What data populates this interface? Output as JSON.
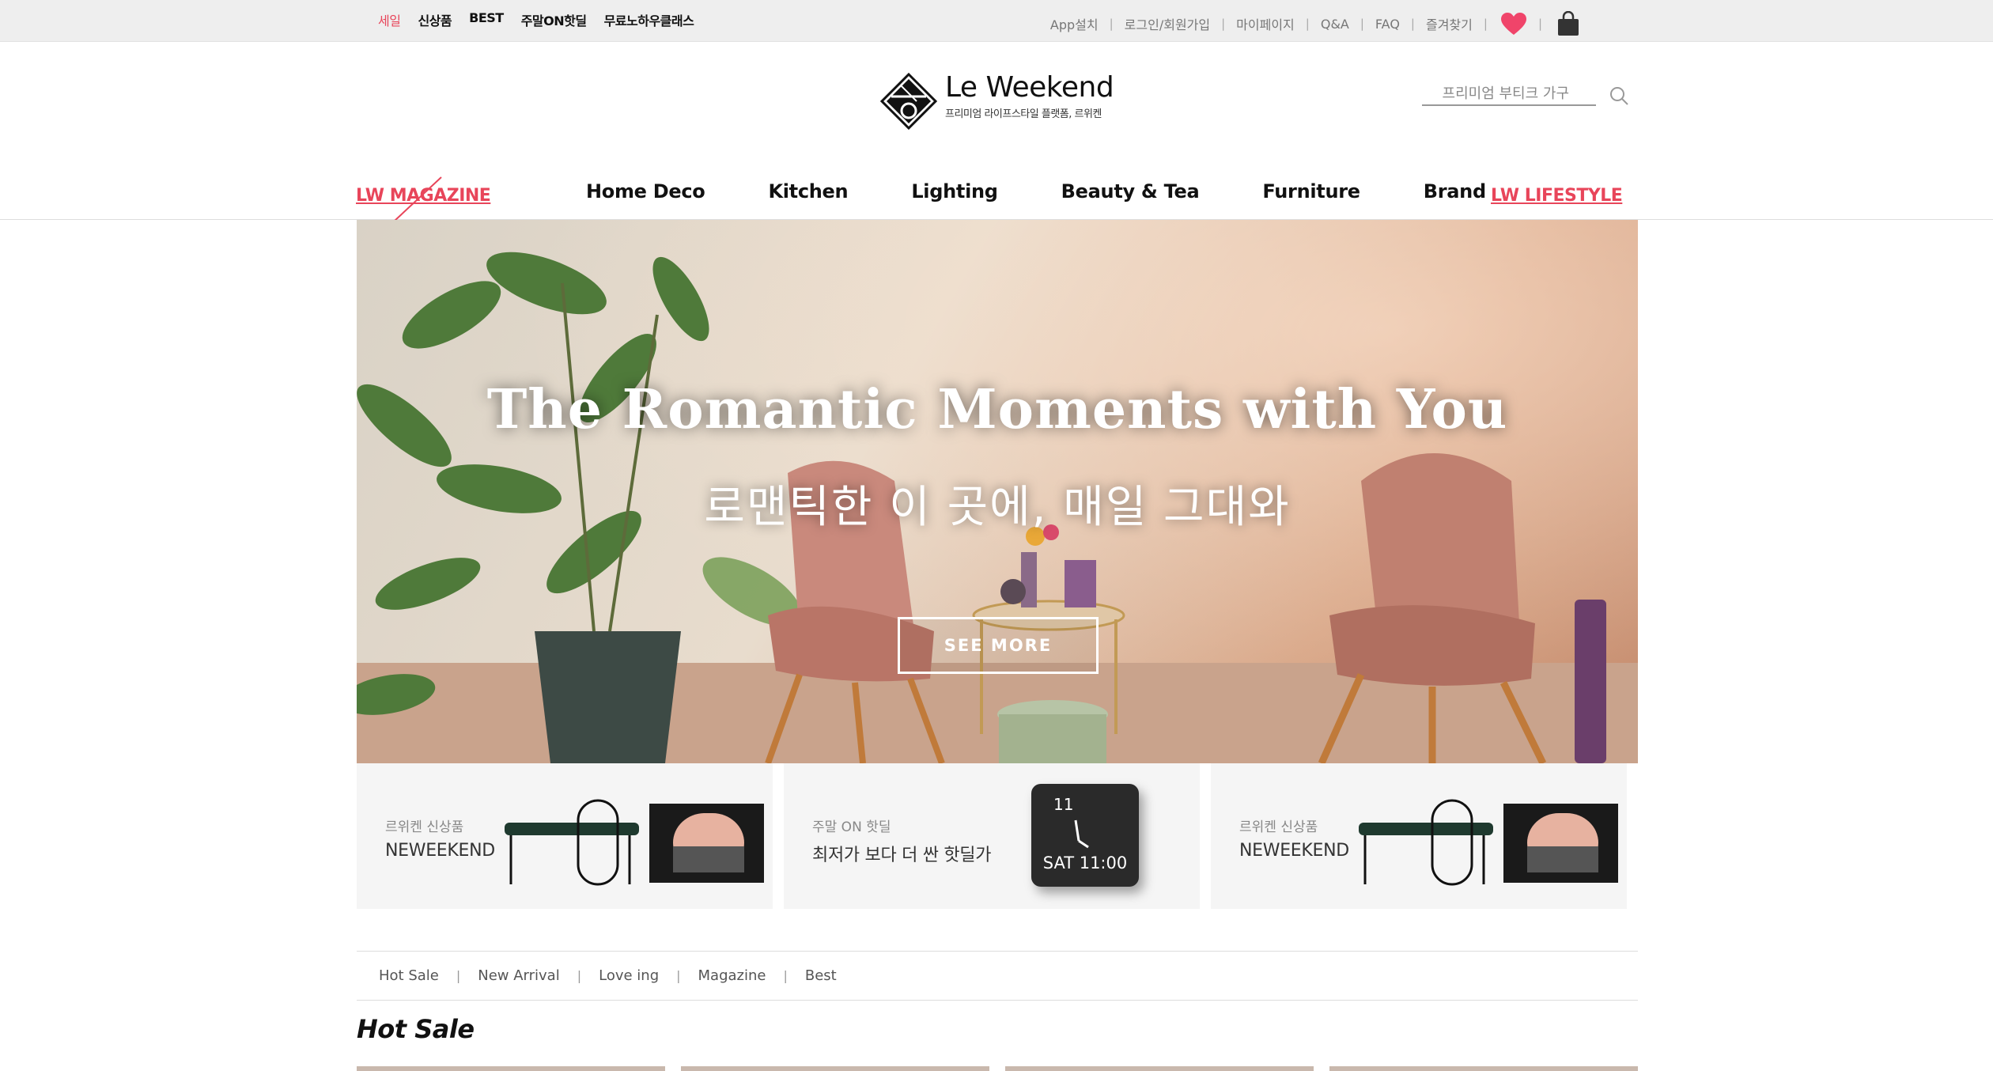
{
  "topbar": {
    "left_links": [
      "세일",
      "신상품",
      "BEST",
      "주말ON핫딜",
      "무료노하우클래스"
    ],
    "right_links": [
      "App설치",
      "로그인/회원가입",
      "마이페이지",
      "Q&A",
      "FAQ",
      "즐겨찾기"
    ]
  },
  "brand": {
    "name": "Le Weekend",
    "tagline": "프리미엄 라이프스타일 플랫폼, 르위켄"
  },
  "search": {
    "placeholder": "프리미엄 부티크 가구"
  },
  "nav": {
    "magazine": "LW MAGAZINE",
    "items": [
      "Home Deco",
      "Kitchen",
      "Lighting",
      "Beauty & Tea",
      "Furniture",
      "Brand"
    ],
    "lifestyle": "LW LIFESTYLE"
  },
  "hero": {
    "title": "The Romantic Moments with You",
    "subtitle": "로맨틱한 이 곳에, 매일 그대와",
    "cta": "SEE MORE"
  },
  "promo_cards": [
    {
      "kicker": "르위켄 신상품",
      "headline": "NEWEEKEND"
    },
    {
      "kicker": "주말 ON 핫딜",
      "headline": "최저가 보다 더 싼 핫딜가",
      "clock_hour": "11",
      "clock_date": "SAT 11:00"
    },
    {
      "kicker": "르위켄 신상품",
      "headline": "NEWEEKEND"
    }
  ],
  "tabs": [
    "Hot Sale",
    "New Arrival",
    "Love ing",
    "Magazine",
    "Best"
  ],
  "section_title": "Hot Sale",
  "colors": {
    "accent": "#e8455a",
    "topbar": "#eeeeee",
    "card_bg": "#f5f5f5"
  },
  "icons": [
    "heart-icon",
    "shopping-bag-icon",
    "search-icon",
    "logo-diamond-icon"
  ]
}
